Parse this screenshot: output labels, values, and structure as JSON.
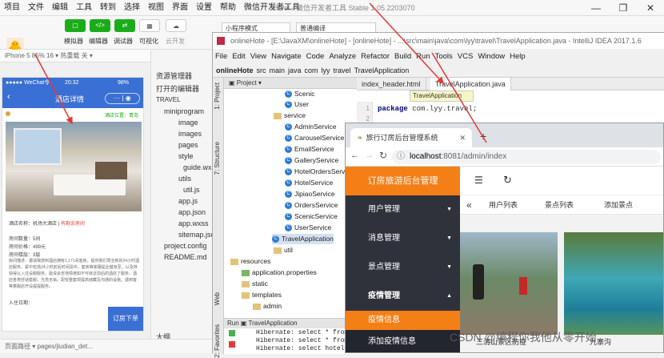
{
  "wx": {
    "menu": [
      "项目",
      "文件",
      "编辑",
      "工具",
      "转到",
      "选择",
      "视图",
      "界面",
      "设置",
      "帮助",
      "微信开发者工具"
    ],
    "title": "travel - 微信开发者工具 Stable 1.05.2203070",
    "toolbar": {
      "simulator": "模拟器",
      "editor": "编辑器",
      "debugger": "调试器",
      "visual": "可视化",
      "cloud": "云开发",
      "mode_select": "小程序模式",
      "compile_select": "普通编译"
    },
    "sim_bar": "iPhone 5 85% 16 ▾    热重载 关 ▾",
    "phone": {
      "carrier": "●●●●● WeChat令",
      "time": "20:32",
      "battery": "98%",
      "nav_title": "酒店详情",
      "location_label": "酒店位置：青岛",
      "hotel_name_label": "酒店名称：机场大酒店",
      "hotel_status": "有剩余房间",
      "price_label": "房间数量：5间",
      "price_value": "房间价格：499元",
      "floor_label": "房间楼层：3层",
      "desc": "房间描述：邀请我感到酒店拥有1,171间客房。提供我们周全新的24小时酒店服务。紧中包括24小时前后时间段中。套房等家服提业健身至，以及特快得以入住设服服务。能说会吉地情使如不可就近前后的酒店了服务。酒店各类舒适套服，光亮无垢。配有整套现提高储藏及沟通的设施。遇到客等着服店开设提提服务。",
      "checkin_label": "入住日期：",
      "order_button": "订房下单"
    },
    "resource_panel": {
      "title": "资源管理器",
      "open_editors": "打开的编辑器",
      "project": "TRAVEL",
      "items": [
        "miniprogram",
        "image",
        "images",
        "pages",
        "style",
        "guide.wxss",
        "utils",
        "util.js",
        "app.js",
        "app.json",
        "app.wxss",
        "sitemap.json",
        "project.config",
        "README.md"
      ],
      "outline": "大纲"
    },
    "bottom_bar": "页面路径 ▾  pages/jiudian_det..."
  },
  "ij": {
    "title": "onlineHote - [E:\\JavaXM\\onlineHote] - [onlineHote] - ...\\src\\main\\java\\com\\lyy\\travel\\TravelApplication.java - IntelliJ IDEA 2017.1.6",
    "menu": [
      "File",
      "Edit",
      "View",
      "Navigate",
      "Code",
      "Analyze",
      "Refactor",
      "Build",
      "Run",
      "Tools",
      "VCS",
      "Window",
      "Help"
    ],
    "crumbs": [
      "onlineHote",
      "src",
      "main",
      "java",
      "com",
      "lyy",
      "travel",
      "TravelApplication"
    ],
    "project_header": "Project",
    "tree": [
      "Scenic",
      "User",
      "service",
      "AdminService",
      "CarouselService",
      "EmailService",
      "GalleryService",
      "HotelOrdersService",
      "HotelService",
      "JipiaoService",
      "OrdersService",
      "ScenicService",
      "UserService",
      "TravelApplication",
      "util",
      "resources",
      "application.properties",
      "static",
      "templates",
      "admin"
    ],
    "tabs": [
      "index_header.html",
      "TravelApplication.java"
    ],
    "tooltip": "TravelApplication",
    "code_kw": "package",
    "code_rest": " com.lyy.travel;",
    "line_numbers": [
      "1",
      "2",
      "3"
    ],
    "side_tabs": [
      "1: Project",
      "7: Structure",
      "Web",
      "2: Favorites"
    ],
    "run_title": "Run",
    "run_app": "TravelApplication",
    "run_lines": [
      "Hibernate: select * from gal",
      "Hibernate: select * from ho",
      "Hibernate: select hotel0_.i"
    ]
  },
  "browser": {
    "tab_title": "旅行订房后台管理系统",
    "url_host": "localhost",
    "url_rest": ":8081/admin/index",
    "logo": "订房旅游后台管理",
    "menu": [
      "用户管理",
      "消息管理",
      "景点管理",
      "疫情管理"
    ],
    "submenu": [
      "疫情信息",
      "添加疫情信息"
    ],
    "tabs": [
      "用户列表",
      "景点列表",
      "添加景点"
    ],
    "captions": [
      "三清山景区防疫",
      "九寨沟"
    ],
    "watermark": "CSDN @编程你我他从零开始"
  },
  "colors": {
    "wechat_green": "#1aad19",
    "admin_orange": "#f57f17",
    "admin_dark": "#2f323a",
    "phone_blue": "#3a70d3",
    "annotation_red": "#e53935"
  }
}
